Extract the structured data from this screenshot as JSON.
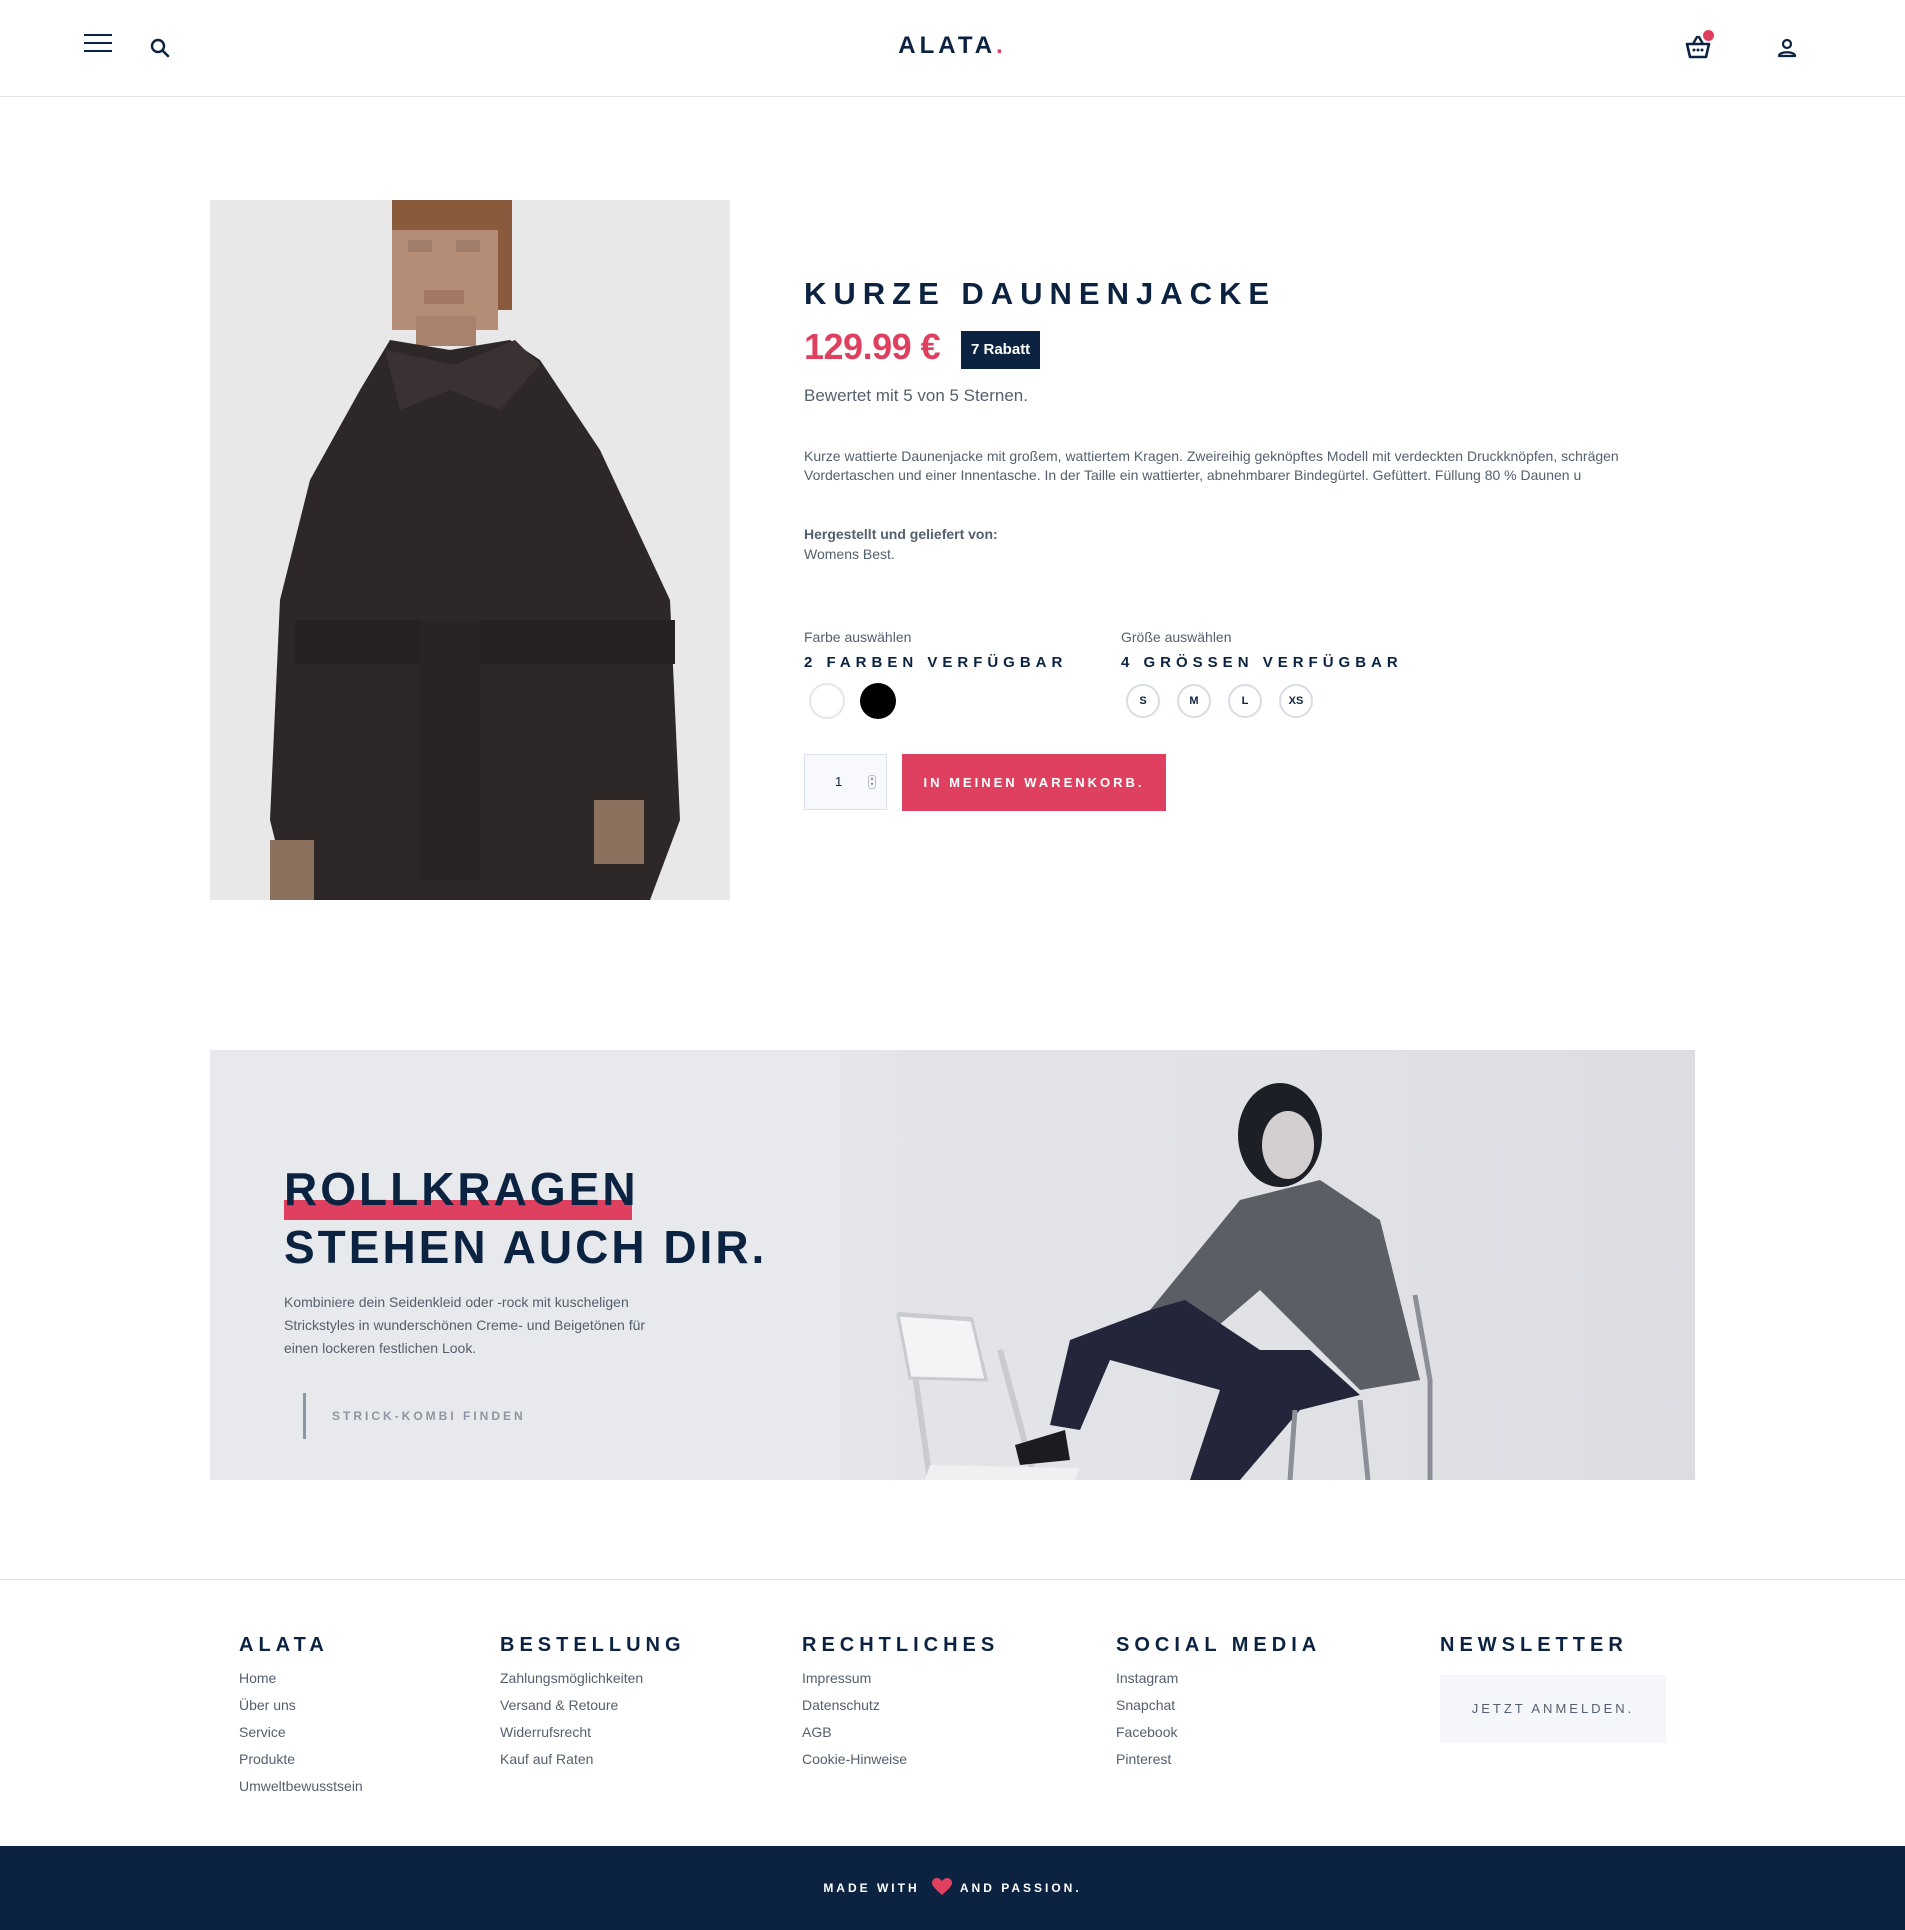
{
  "header": {
    "brand": "ALATA",
    "brand_dot": ".",
    "icons": {
      "menu": "menu-icon",
      "search": "search-icon",
      "basket": "basket-icon",
      "user": "user-icon"
    },
    "accent_color": "#e0405f"
  },
  "product": {
    "title": "KURZE DAUNENJACKE",
    "price": "129.99 €",
    "discount_badge": "7 Rabatt",
    "rating_text": "Bewertet mit 5 von 5 Sternen.",
    "description": "Kurze wattierte Daunenjacke mit großem, wattiertem Kragen. Zweireihig geknöpftes Modell mit verdeckten Druckknöpfen, schrägen Vordertaschen und einer Innentasche. In der Taille ein wattierter, abnehmbarer Bindegürtel. Gefüttert. Füllung 80 % Daunen u",
    "maker_label": "Hergestellt und geliefert von:",
    "maker_value": "Womens Best.",
    "color_label": "Farbe auswählen",
    "color_count": "2 FARBEN VERFÜGBAR",
    "colors": [
      "#ffffff",
      "#000000"
    ],
    "size_label": "Größe auswählen",
    "size_count": "4 GRÖSSEN VERFÜGBAR",
    "sizes": [
      "S",
      "M",
      "L",
      "XS"
    ],
    "quantity": "1",
    "cart_button": "IN MEINEN WARENKORB."
  },
  "banner": {
    "headline_line1": "ROLLKRAGEN",
    "headline_line2": "STEHEN AUCH DIR.",
    "text": "Kombiniere dein Seidenkleid oder -rock mit kuscheligen Strickstyles in wunderschönen Creme- und Beigetönen für einen lockeren festlichen Look.",
    "cta": "STRICK-KOMBI FINDEN"
  },
  "footer": {
    "columns": [
      {
        "title": "ALATA",
        "links": [
          "Home",
          "Über uns",
          "Service",
          "Produkte",
          "Umweltbewusstsein"
        ]
      },
      {
        "title": "BESTELLUNG",
        "links": [
          "Zahlungsmöglichkeiten",
          "Versand & Retoure",
          "Widerrufsrecht",
          "Kauf auf Raten"
        ]
      },
      {
        "title": "RECHTLICHES",
        "links": [
          "Impressum",
          "Datenschutz",
          "AGB",
          "Cookie-Hinweise"
        ]
      },
      {
        "title": "SOCIAL MEDIA",
        "links": [
          "Instagram",
          "Snapchat",
          "Facebook",
          "Pinterest"
        ]
      },
      {
        "title": "NEWSLETTER",
        "links": []
      }
    ],
    "newsletter_button": "JETZT ANMELDEN.",
    "made_with": "MADE WITH",
    "and_passion": "AND PASSION.",
    "heart_icon": "heart-icon",
    "bar_color": "#0b2340"
  }
}
